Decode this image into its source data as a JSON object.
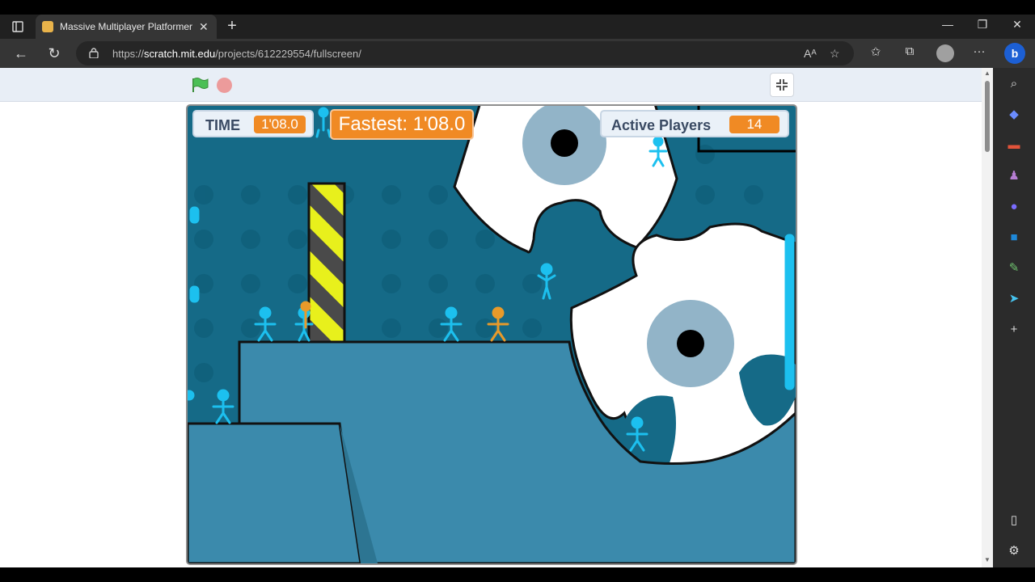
{
  "browser": {
    "tab_title": "Massive Multiplayer Platformer v",
    "tab_close": "✕",
    "new_tab": "+",
    "url_prefix": "https://",
    "url_host": "scratch.mit.edu",
    "url_path": "/projects/612229554/fullscreen/",
    "window_controls": [
      "—",
      "❐",
      "✕"
    ]
  },
  "scratch": {
    "hud": {
      "time_label": "TIME",
      "time_value": "1'08.0",
      "fastest": "Fastest: 1'08.0",
      "players_label": "Active Players",
      "players_value": "14"
    }
  },
  "colors": {
    "accent_orange": "#f08a24",
    "stage_bg": "#156a87",
    "platform": "#3b8aac",
    "player_blue": "#1cc0ef",
    "player_orange": "#e89a2a"
  },
  "icons": {
    "tabs": "tab-actions-icon",
    "back": "back-arrow-icon",
    "refresh": "refresh-icon",
    "lock": "lock-icon",
    "read_aloud": "read-aloud-icon",
    "add_favorite": "add-favorite-icon",
    "favorites": "favorites-icon",
    "collections": "collections-icon",
    "profile": "profile-avatar-icon",
    "more": "more-icon",
    "copilot": "bing-copilot-icon"
  }
}
